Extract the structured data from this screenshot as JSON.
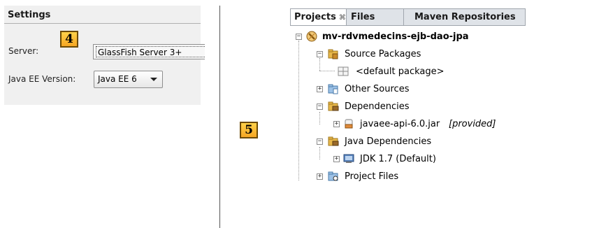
{
  "settings": {
    "title": "Settings",
    "server_label": "Server:",
    "server_value": "GlassFish Server 3+",
    "javaee_label": "Java EE Version:",
    "javaee_value": "Java EE 6"
  },
  "badges": {
    "left": "4",
    "right": "5"
  },
  "projects": {
    "tabs": [
      {
        "label": "Projects",
        "close": "⌘",
        "active": true
      },
      {
        "label": "Files"
      },
      {
        "label": "Maven Repositories"
      }
    ],
    "tree": {
      "root": "mv-rdvmedecins-ejb-dao-jpa",
      "source_packages": "Source Packages",
      "default_package": "<default package>",
      "other_sources": "Other Sources",
      "dependencies": "Dependencies",
      "javaee_jar": "javaee-api-6.0.jar",
      "javaee_jar_scope": "[provided]",
      "java_dependencies": "Java Dependencies",
      "jdk": "JDK 1.7 (Default)",
      "project_files": "Project Files"
    }
  }
}
